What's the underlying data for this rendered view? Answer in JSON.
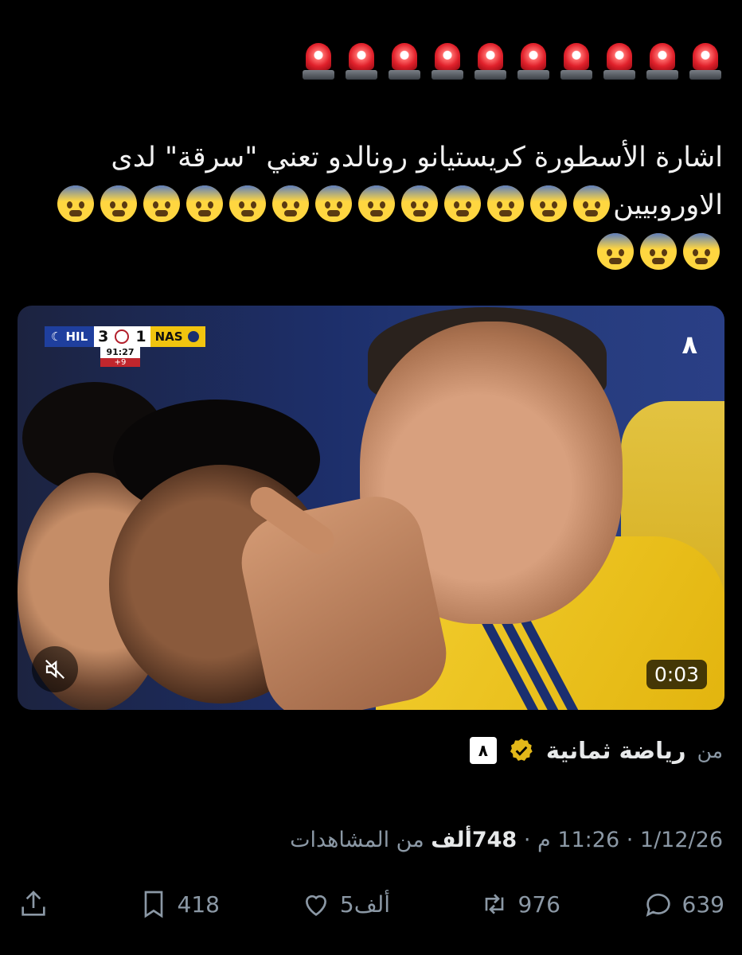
{
  "siren_row": {
    "count": 10,
    "icon": "police-siren-icon"
  },
  "tweet": {
    "line1": "اشارة الأسطورة كريستيانو رونالدو تعني \"سرقة\" لدى",
    "line2_text": "الاوروبيين",
    "emoji_count": 16,
    "emoji_icon": "fearful-face-icon"
  },
  "media": {
    "scorebug": {
      "home_team": "HIL",
      "home_score": "3",
      "away_score": "1",
      "away_team": "NAS",
      "clock": "91:27",
      "added_time": "+9"
    },
    "brand_mark": "٨",
    "duration": "0:03"
  },
  "source": {
    "from_label": "من",
    "account_name": "رياضة ثمانية",
    "logo_text": "٨"
  },
  "meta": {
    "date": "1/12/26",
    "separator": "·",
    "time": "11:26 م",
    "views_value": "748ألف",
    "views_label": "من المشاهدات"
  },
  "actions": {
    "replies": "639",
    "reposts": "976",
    "likes": "5ألف",
    "bookmarks": "418"
  }
}
